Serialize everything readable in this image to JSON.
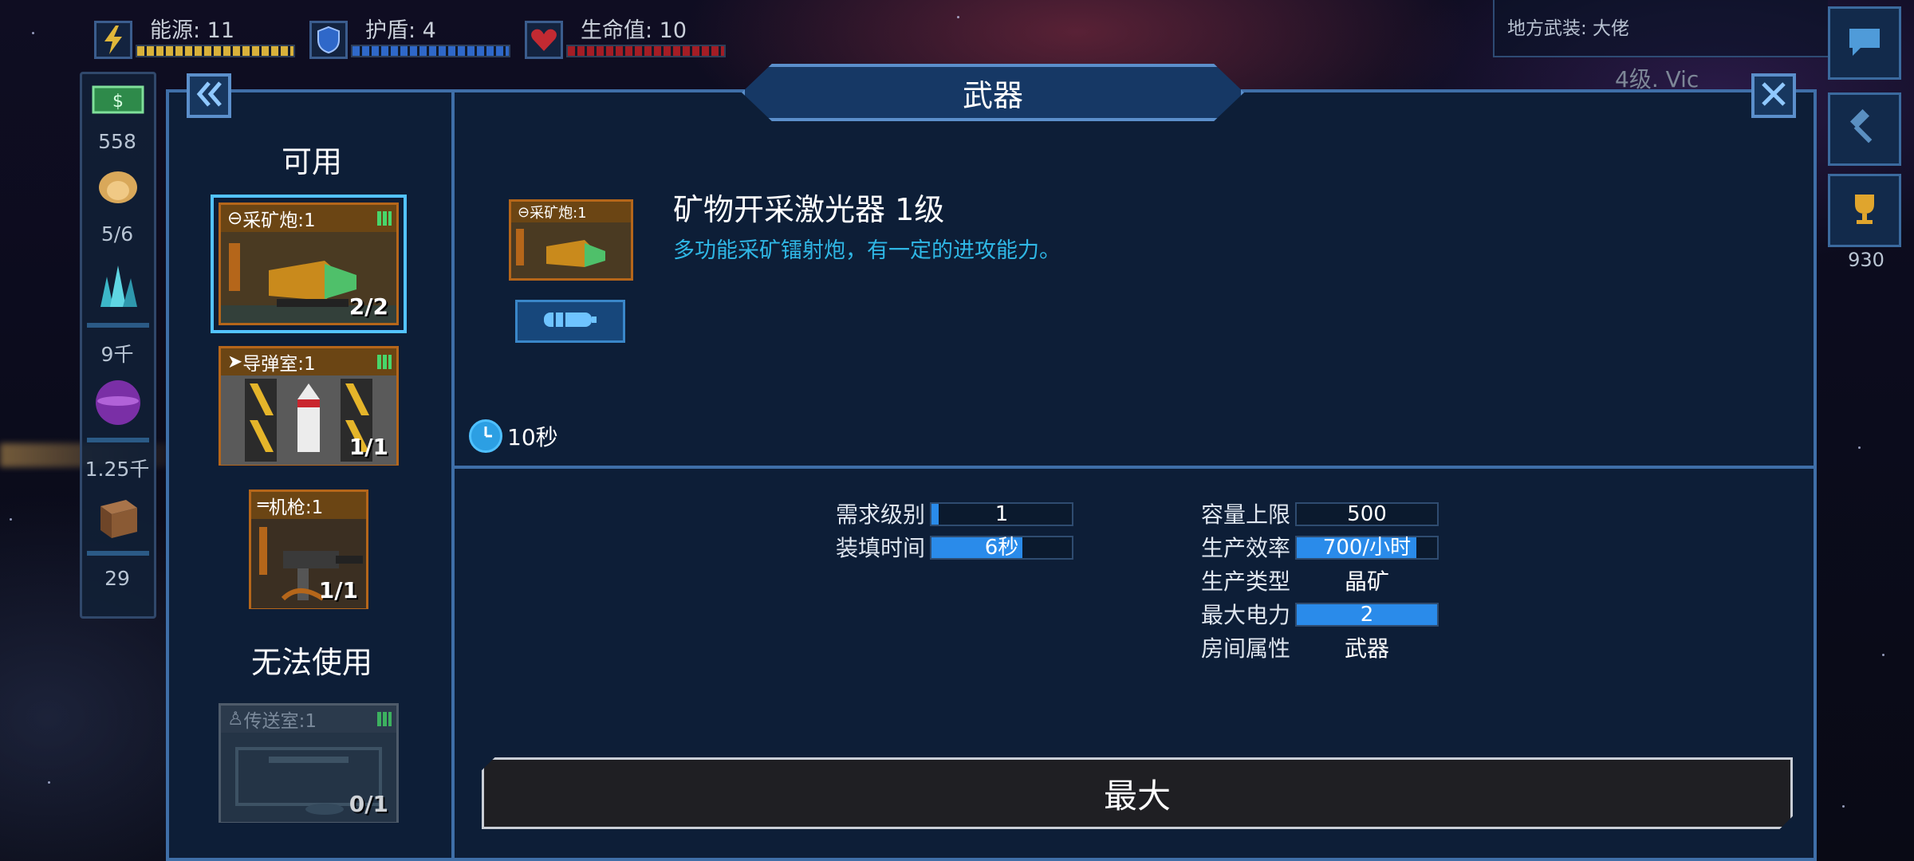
{
  "hud": {
    "energy_label": "能源: 11",
    "shield_label": "护盾: 4",
    "health_label": "生命值: 10",
    "energy_level": 1.0,
    "shield_level": 1.0,
    "health_level": 1.0
  },
  "enemy": {
    "weapon_label": "地方武装: 大佬",
    "level_text": "4级. Vic"
  },
  "resources": {
    "money": "558",
    "crew": "5/6",
    "minerals": "9千",
    "gas": "1.25千",
    "supplies": "29",
    "trophies": "930"
  },
  "panel": {
    "title": "武器",
    "available_label": "可用",
    "unavailable_label": "无法使用"
  },
  "available_weapons": [
    {
      "name": "采矿炮:1",
      "count": "2/2"
    },
    {
      "name": "导弹室:1",
      "count": "1/1"
    },
    {
      "name": "机枪:1",
      "count": "1/1"
    }
  ],
  "unavailable_weapons": [
    {
      "name": "传送室:1",
      "count": "0/1"
    }
  ],
  "detail": {
    "thumb_label": "采矿炮:1",
    "name": "矿物开采激光器 1级",
    "description": "多功能采矿镭射炮，有一定的进攻能力。",
    "build_time": "10秒"
  },
  "stats_left": [
    {
      "label": "需求级别",
      "value": "1",
      "fill": 0.05
    },
    {
      "label": "装填时间",
      "value": "6秒",
      "fill": 0.65
    }
  ],
  "stats_right": [
    {
      "label": "容量上限",
      "value": "500",
      "fill": 0
    },
    {
      "label": "生产效率",
      "value": "700/小时",
      "fill": 0.85
    },
    {
      "label": "生产类型",
      "value": "晶矿"
    },
    {
      "label": "最大电力",
      "value": "2",
      "fill": 1.0
    },
    {
      "label": "房间属性",
      "value": "武器"
    }
  ],
  "max_button_label": "最大",
  "colors": {
    "energy": "#d8b13b",
    "shield": "#2f68c9",
    "health": "#a31d25",
    "accent": "#2fb7e5",
    "panel_border": "#3f6fa8"
  }
}
